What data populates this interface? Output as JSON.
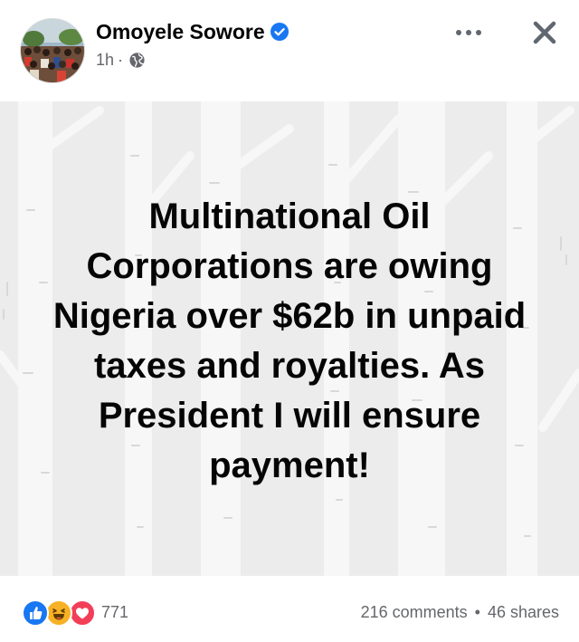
{
  "post": {
    "author": "Omoyele Sowore",
    "time": "1h",
    "time_separator": "·",
    "text": "Multinational Oil Corporations are owing Nigeria over $62b in unpaid taxes and royalties. As President I will ensure payment!"
  },
  "icons": {
    "verified": "verified-badge-icon",
    "audience": "globe-icon",
    "more": "more-options-icon",
    "close": "close-icon",
    "reactions": [
      "like-icon",
      "haha-icon",
      "love-icon"
    ]
  },
  "engagement": {
    "reactions_count": "771",
    "comments": "216 comments",
    "separator": "•",
    "shares": "46 shares"
  },
  "colors": {
    "accent": "#1877f2",
    "background_card": "#ececec",
    "muted_text": "#65676b",
    "like": "#1877f2",
    "haha": "#f7b125",
    "love": "#f33e58"
  }
}
